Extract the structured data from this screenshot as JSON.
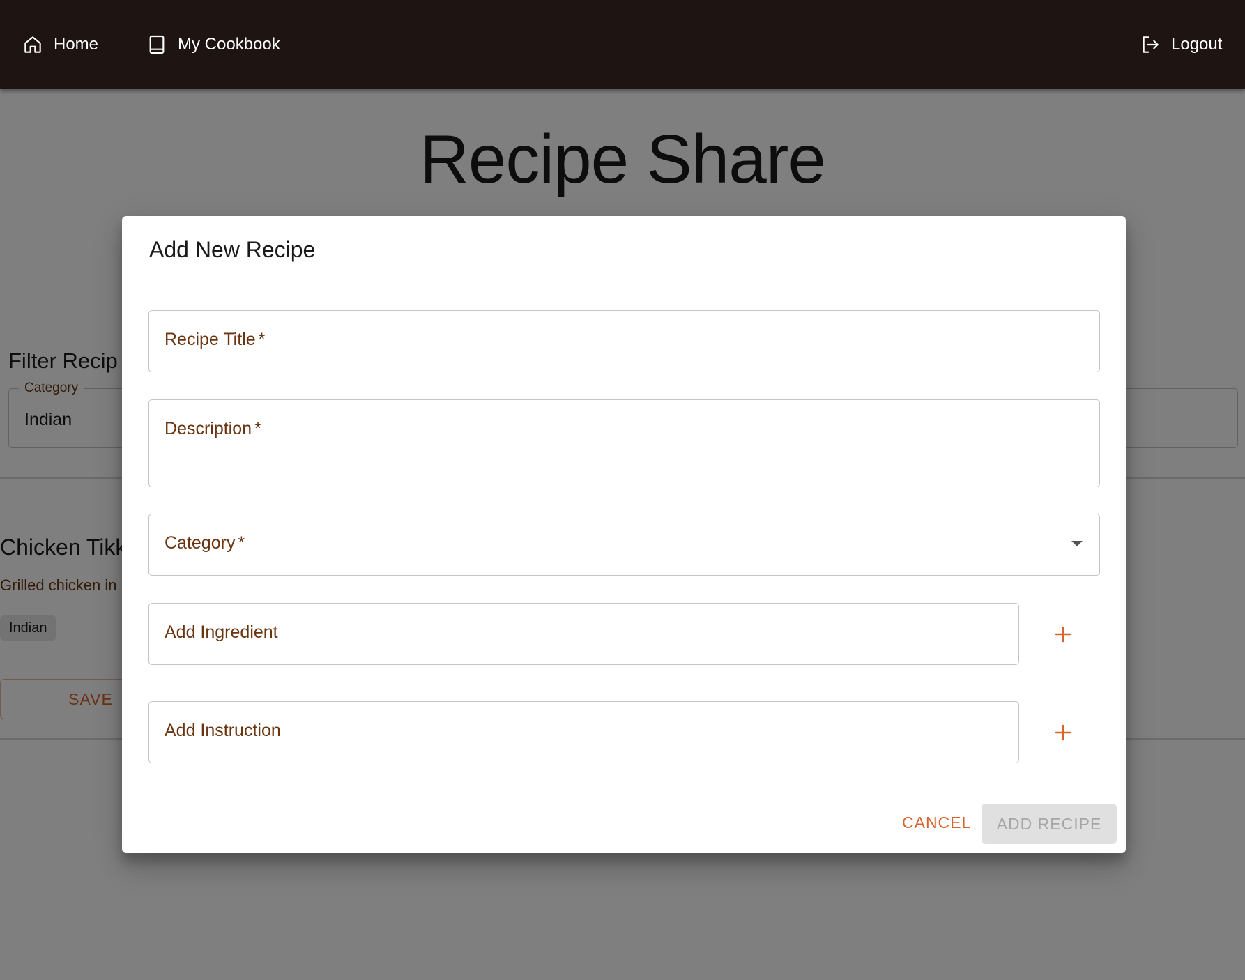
{
  "nav": {
    "home_label": "Home",
    "cookbook_label": "My Cookbook",
    "logout_label": "Logout",
    "home_icon": "home-icon",
    "cookbook_icon": "book-icon",
    "logout_icon": "logout-icon",
    "background": "#1e1512"
  },
  "page": {
    "title": "Recipe Share"
  },
  "filter": {
    "title": "Filter Recip",
    "category_label": "Category",
    "category_value": "Indian"
  },
  "recipe_card": {
    "title": "Chicken Tikk",
    "description": "Grilled chicken in",
    "category_chip": "Indian",
    "save_label": "SAVE"
  },
  "dialog": {
    "title": "Add New Recipe",
    "fields": {
      "recipe_title": {
        "label": "Recipe Title",
        "required_mark": "*",
        "value": ""
      },
      "description": {
        "label": "Description",
        "required_mark": "*",
        "value": ""
      },
      "category": {
        "label": "Category",
        "required_mark": "*",
        "value": ""
      },
      "ingredient": {
        "label": "Add Ingredient",
        "value": ""
      },
      "instruction": {
        "label": "Add Instruction",
        "value": ""
      }
    },
    "add_icon": "plus-icon",
    "cancel_label": "CANCEL",
    "submit_label": "ADD RECIPE",
    "submit_disabled": true
  },
  "colors": {
    "accent": "#d9622b",
    "label_brown": "#6b3410",
    "backdrop": "rgba(0,0,0,0.5)"
  }
}
